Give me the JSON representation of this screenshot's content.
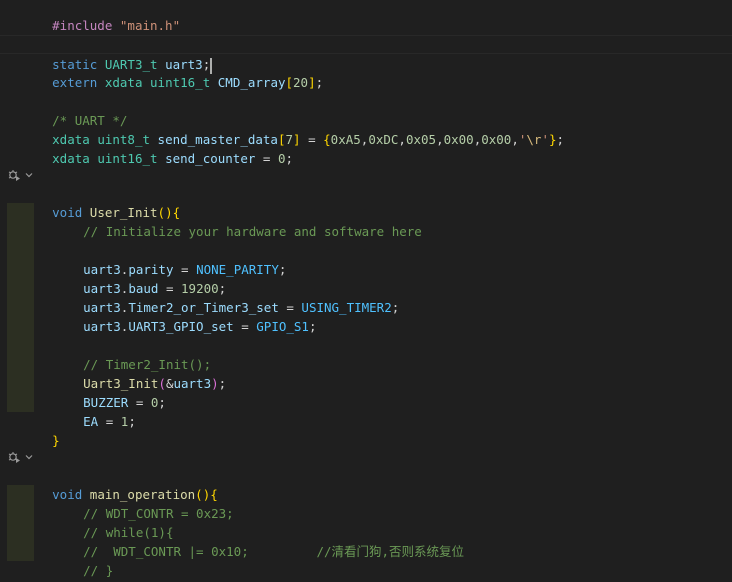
{
  "editor": {
    "language": "C",
    "theme": "dark",
    "codelens_icon": "debug-run-icon",
    "codelens_chevron": "chevron-down-icon",
    "lines": {
      "l1": {
        "a": "#include",
        "b": " ",
        "c": "\"main.h\""
      },
      "l3": {
        "a": "static",
        "b": " ",
        "c": "UART3_t",
        "d": " ",
        "e": "uart3",
        "f": ";"
      },
      "l4": {
        "a": "extern",
        "b": " ",
        "c": "xdata",
        "d": " ",
        "e": "uint16_t",
        "f": " ",
        "g": "CMD_array",
        "h": "[",
        "i": "20",
        "j": "]",
        "k": ";"
      },
      "l6": {
        "a": "/* UART */"
      },
      "l7": {
        "a": "xdata",
        "b": " ",
        "c": "uint8_t",
        "d": " ",
        "e": "send_master_data",
        "f": "[",
        "g": "7",
        "h": "]",
        "i": " = ",
        "j": "{",
        "k": "0xA5",
        "l": ",",
        "m": "0xDC",
        "n": ",",
        "o": "0x05",
        "p": ",",
        "q": "0x00",
        "r": ",",
        "s": "0x00",
        "t": ",",
        "u": "'",
        "v": "\\r",
        "w": "'",
        "x": "}",
        "y": ";"
      },
      "l8": {
        "a": "xdata",
        "b": " ",
        "c": "uint16_t",
        "d": " ",
        "e": "send_counter",
        "f": " = ",
        "g": "0",
        "h": ";"
      },
      "l10": {
        "a": "void",
        "b": " ",
        "c": "User_Init",
        "d": "(",
        "e": ")",
        "f": "{"
      },
      "l11": {
        "a": "// Initialize your hardware and software here"
      },
      "l13": {
        "a": "uart3",
        "b": ".",
        "c": "parity",
        "d": " = ",
        "e": "NONE_PARITY",
        "f": ";"
      },
      "l14": {
        "a": "uart3",
        "b": ".",
        "c": "baud",
        "d": " = ",
        "e": "19200",
        "f": ";"
      },
      "l15": {
        "a": "uart3",
        "b": ".",
        "c": "Timer2_or_Timer3_set",
        "d": " = ",
        "e": "USING_TIMER2",
        "f": ";"
      },
      "l16": {
        "a": "uart3",
        "b": ".",
        "c": "UART3_GPIO_set",
        "d": " = ",
        "e": "GPIO_S1",
        "f": ";"
      },
      "l18": {
        "a": "// Timer2_Init();"
      },
      "l19": {
        "a": "Uart3_Init",
        "b": "(",
        "c": "&",
        "d": "uart3",
        "e": ")",
        "f": ";"
      },
      "l20": {
        "a": "BUZZER",
        "b": " = ",
        "c": "0",
        "d": ";"
      },
      "l21": {
        "a": "EA",
        "b": " = ",
        "c": "1",
        "d": ";"
      },
      "l22": {
        "a": "}"
      },
      "l24": {
        "a": "void",
        "b": " ",
        "c": "main_operation",
        "d": "(",
        "e": ")",
        "f": "{"
      },
      "l25": {
        "a": "// WDT_CONTR = 0x23;"
      },
      "l26": {
        "a": "// while(1){"
      },
      "l27": {
        "a": "//  WDT_CONTR |= 0x10;         //清看门狗,否则系统复位"
      },
      "l28": {
        "a": "// }"
      },
      "l29": {
        "a": "}"
      }
    }
  }
}
